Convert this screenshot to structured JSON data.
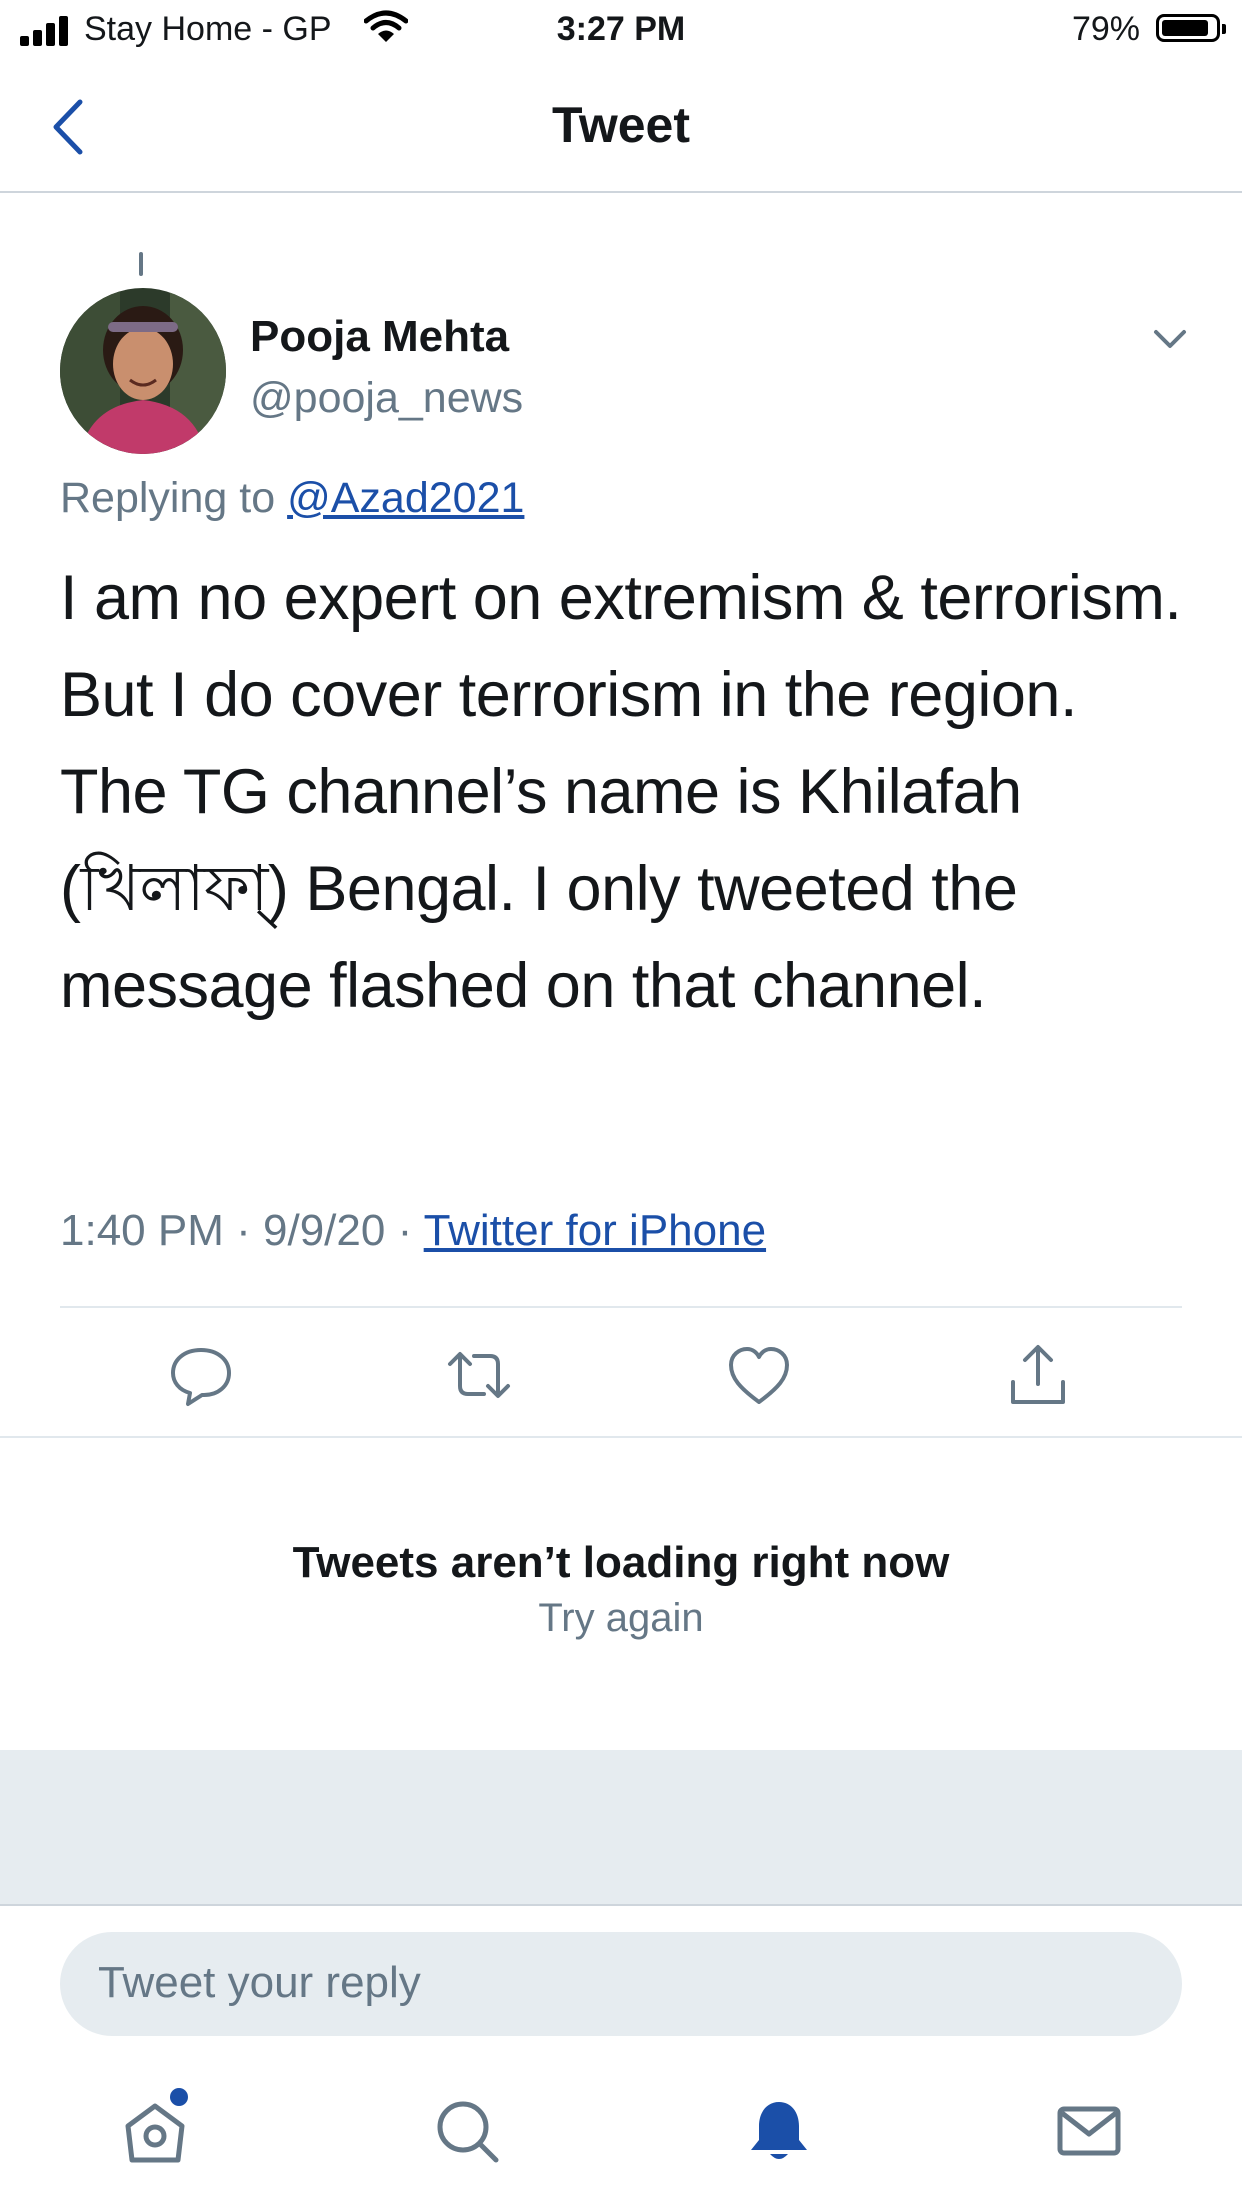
{
  "status_bar": {
    "carrier": "Stay Home - GP",
    "time": "3:27 PM",
    "battery_percent": "79%",
    "battery_level": 0.79
  },
  "nav": {
    "title": "Tweet",
    "back_icon": "chevron-left-icon"
  },
  "tweet": {
    "author_name": "Pooja Mehta",
    "author_handle": "@pooja_news",
    "replying_prefix": "Replying to",
    "replying_to": "@Azad2021",
    "text": "I am no expert on extremism & terrorism. But I do cover terrorism in the region. The TG channel’s name is Khilafah (খিলাফা্) Bengal. I only tweeted the message flashed on that channel.",
    "time": "1:40 PM",
    "date": "9/9/20",
    "source": "Twitter for iPhone",
    "actions": [
      "reply-icon",
      "retweet-icon",
      "like-icon",
      "share-icon"
    ]
  },
  "replies": {
    "error_title": "Tweets aren’t loading right now",
    "retry_label": "Try again"
  },
  "composer": {
    "placeholder": "Tweet your reply"
  },
  "tab_bar": {
    "tabs": [
      "home-icon",
      "search-icon",
      "notifications-icon",
      "messages-icon"
    ],
    "active": "notifications-icon"
  },
  "colors": {
    "accent": "#1b4fa8",
    "secondary_text": "#657786",
    "divider": "#e1e8ed",
    "panel": "#e6ecf0"
  }
}
